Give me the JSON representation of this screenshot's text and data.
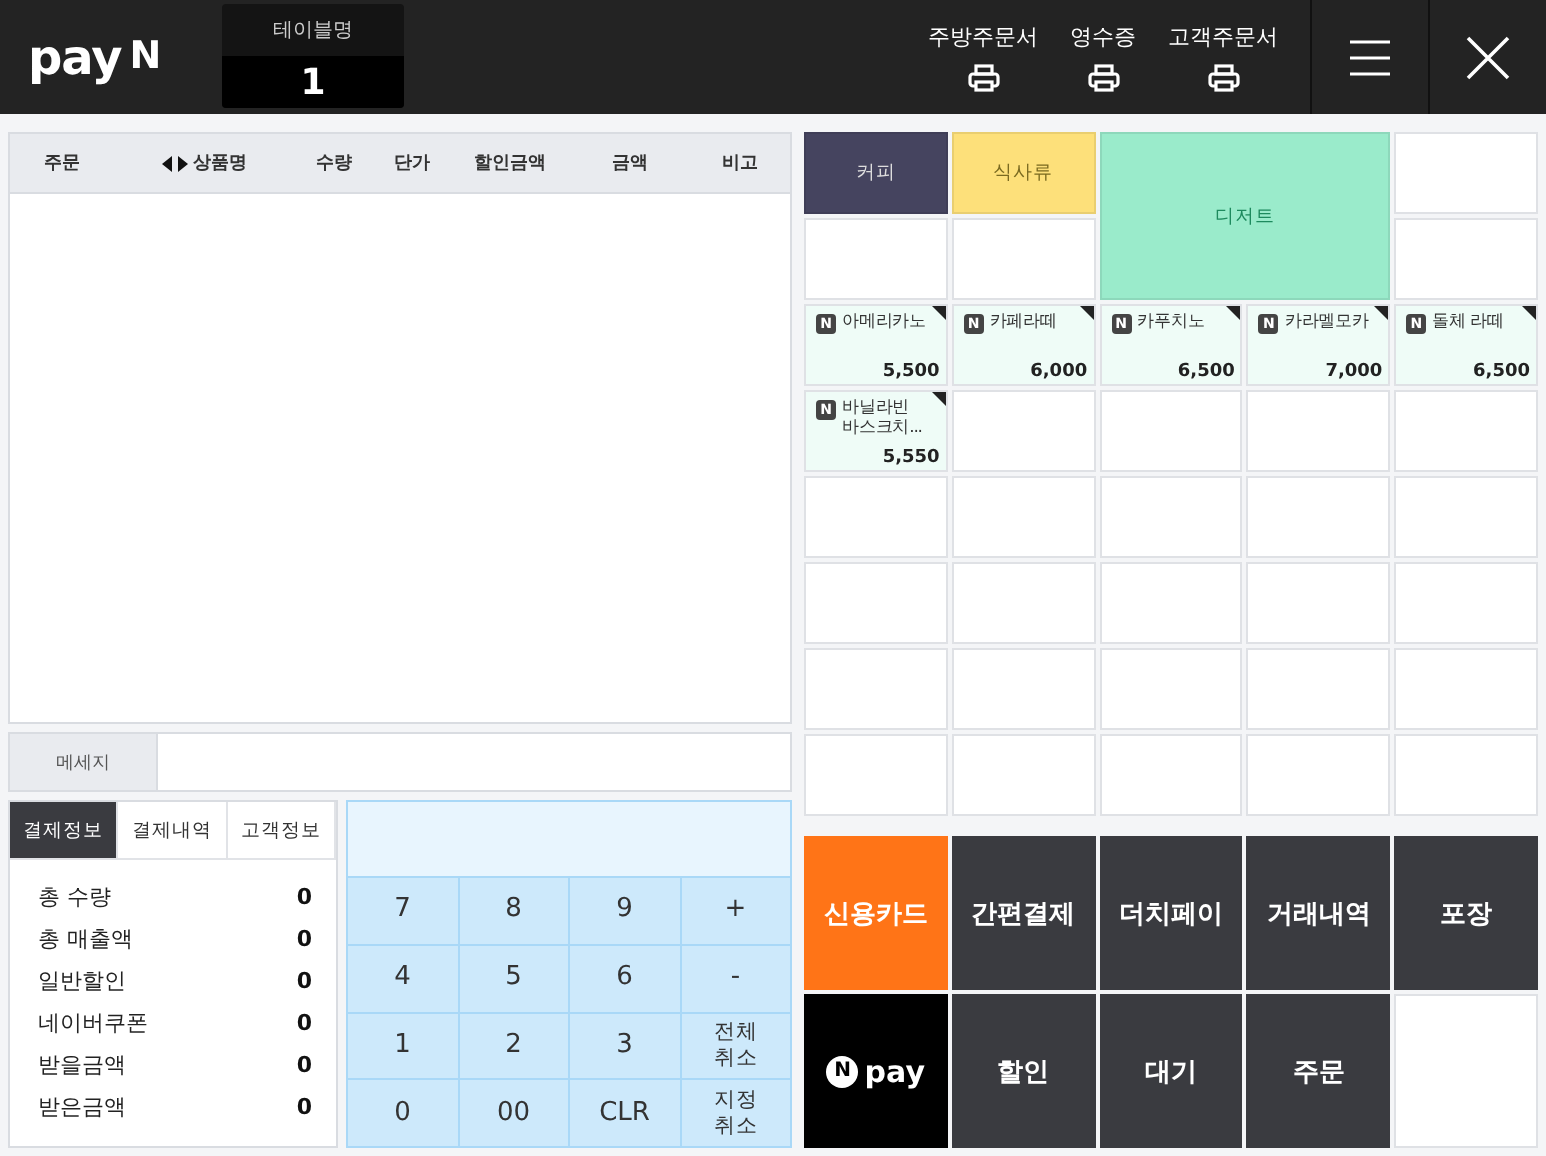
{
  "header": {
    "logo": {
      "text": "pay",
      "mark": "N"
    },
    "table_name": {
      "label": "테이블명",
      "value": "1"
    },
    "print_buttons": [
      {
        "label": "주방주문서"
      },
      {
        "label": "영수증"
      },
      {
        "label": "고객주문서"
      }
    ]
  },
  "order_table": {
    "columns": [
      {
        "label": "주문",
        "sortable": false
      },
      {
        "label": "상품명",
        "sortable": true
      },
      {
        "label": "수량",
        "sortable": false
      },
      {
        "label": "단가",
        "sortable": false
      },
      {
        "label": "할인금액",
        "sortable": false
      },
      {
        "label": "금액",
        "sortable": false
      },
      {
        "label": "비고",
        "sortable": false
      }
    ]
  },
  "message": {
    "label": "메세지"
  },
  "info_tabs": [
    {
      "label": "결제정보",
      "selected": true
    },
    {
      "label": "결제내역",
      "selected": false
    },
    {
      "label": "고객정보",
      "selected": false
    }
  ],
  "totals": [
    {
      "label": "총 수량",
      "value": "0"
    },
    {
      "label": "총 매출액",
      "value": "0"
    },
    {
      "label": "일반할인",
      "value": "0"
    },
    {
      "label": "네이버쿠폰",
      "value": "0"
    },
    {
      "label": "받을금액",
      "value": "0"
    },
    {
      "label": "받은금액",
      "value": "0"
    }
  ],
  "keypad": [
    {
      "label": "7"
    },
    {
      "label": "8"
    },
    {
      "label": "9"
    },
    {
      "label": "+"
    },
    {
      "label": "4"
    },
    {
      "label": "5"
    },
    {
      "label": "6"
    },
    {
      "label": "-"
    },
    {
      "label": "1"
    },
    {
      "label": "2"
    },
    {
      "label": "3"
    },
    {
      "label": "전체\n취소"
    },
    {
      "label": "0"
    },
    {
      "label": "00"
    },
    {
      "label": "CLR"
    },
    {
      "label": "지정\n취소"
    }
  ],
  "menu_grid": [
    {
      "kind": "category",
      "label": "커피",
      "color": "#45445f"
    },
    {
      "kind": "category",
      "label": "식사류",
      "color": "#fde07a"
    },
    {
      "kind": "large_category",
      "label": "디저트",
      "color": "#9aebcb"
    },
    {
      "kind": "empty"
    },
    {
      "kind": "empty"
    },
    {
      "kind": "empty"
    },
    {
      "kind": "empty"
    },
    {
      "kind": "product",
      "badge": "N",
      "name": "아메리카노",
      "price": "5,500"
    },
    {
      "kind": "product",
      "badge": "N",
      "name": "카페라떼",
      "price": "6,000"
    },
    {
      "kind": "product",
      "badge": "N",
      "name": "카푸치노",
      "price": "6,500"
    },
    {
      "kind": "product",
      "badge": "N",
      "name": "카라멜모카",
      "price": "7,000"
    },
    {
      "kind": "product",
      "badge": "N",
      "name": "돌체 라떼",
      "price": "6,500"
    },
    {
      "kind": "product",
      "badge": "N",
      "name": "바닐라빈 바스크치...",
      "price": "5,550"
    },
    {
      "kind": "empty"
    },
    {
      "kind": "empty"
    },
    {
      "kind": "empty"
    },
    {
      "kind": "empty"
    },
    {
      "kind": "empty"
    },
    {
      "kind": "empty"
    },
    {
      "kind": "empty"
    },
    {
      "kind": "empty"
    },
    {
      "kind": "empty"
    },
    {
      "kind": "empty"
    },
    {
      "kind": "empty"
    },
    {
      "kind": "empty"
    },
    {
      "kind": "empty"
    },
    {
      "kind": "empty"
    },
    {
      "kind": "empty"
    },
    {
      "kind": "empty"
    },
    {
      "kind": "empty"
    },
    {
      "kind": "empty"
    },
    {
      "kind": "empty"
    },
    {
      "kind": "empty"
    },
    {
      "kind": "empty"
    },
    {
      "kind": "empty"
    },
    {
      "kind": "empty"
    },
    {
      "kind": "empty"
    }
  ],
  "payment_buttons": [
    {
      "kind": "highlight",
      "label": "신용카드"
    },
    {
      "kind": "normal",
      "label": "간편결제"
    },
    {
      "kind": "normal",
      "label": "더치페이"
    },
    {
      "kind": "normal",
      "label": "거래내역"
    },
    {
      "kind": "normal",
      "label": "포장"
    },
    {
      "kind": "npay",
      "mark": "N",
      "label": "pay"
    },
    {
      "kind": "normal",
      "label": "할인"
    },
    {
      "kind": "normal",
      "label": "대기"
    },
    {
      "kind": "normal",
      "label": "주문"
    },
    {
      "kind": "empty"
    }
  ]
}
